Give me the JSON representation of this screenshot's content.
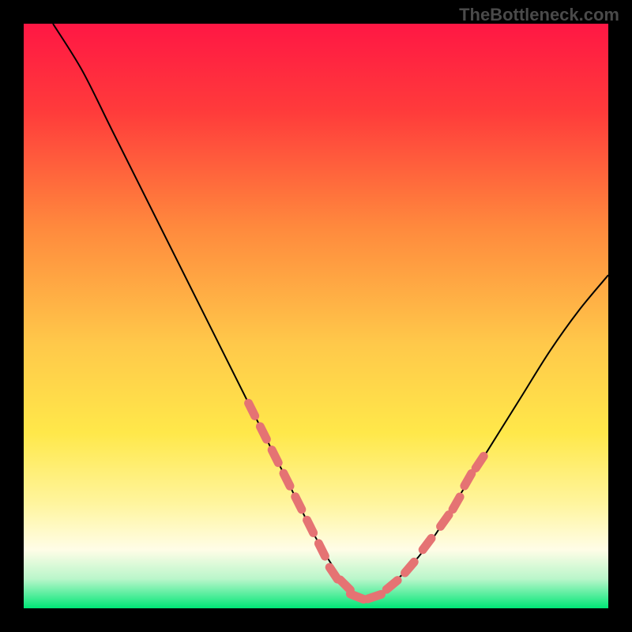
{
  "watermark": "TheBottleneck.com",
  "chart_data": {
    "type": "line",
    "title": "",
    "xlabel": "",
    "ylabel": "",
    "xlim": [
      0,
      100
    ],
    "ylim": [
      0,
      100
    ],
    "gradient_stops": [
      {
        "offset": 0,
        "color": "#ff1744"
      },
      {
        "offset": 15,
        "color": "#ff3b3b"
      },
      {
        "offset": 35,
        "color": "#ff8a3d"
      },
      {
        "offset": 55,
        "color": "#ffc94a"
      },
      {
        "offset": 70,
        "color": "#ffe84a"
      },
      {
        "offset": 82,
        "color": "#fff59d"
      },
      {
        "offset": 90,
        "color": "#fffde7"
      },
      {
        "offset": 95,
        "color": "#b9f6ca"
      },
      {
        "offset": 100,
        "color": "#00e676"
      }
    ],
    "series": [
      {
        "name": "bottleneck-curve",
        "x": [
          5,
          10,
          15,
          20,
          25,
          30,
          35,
          40,
          45,
          50,
          55,
          57,
          60,
          65,
          70,
          75,
          80,
          85,
          90,
          95,
          100
        ],
        "y": [
          100,
          92,
          82,
          72,
          62,
          52,
          42,
          32,
          22,
          12,
          4,
          2,
          2,
          6,
          12,
          20,
          28,
          36,
          44,
          51,
          57
        ]
      }
    ],
    "markers": {
      "name": "highlight-dots",
      "color": "#e57373",
      "points": [
        {
          "x": 39,
          "y": 34
        },
        {
          "x": 41,
          "y": 30
        },
        {
          "x": 43,
          "y": 26
        },
        {
          "x": 45,
          "y": 22
        },
        {
          "x": 47,
          "y": 18
        },
        {
          "x": 49,
          "y": 14
        },
        {
          "x": 51,
          "y": 10
        },
        {
          "x": 53,
          "y": 6
        },
        {
          "x": 55,
          "y": 4
        },
        {
          "x": 57,
          "y": 2
        },
        {
          "x": 60,
          "y": 2
        },
        {
          "x": 63,
          "y": 4
        },
        {
          "x": 66,
          "y": 7
        },
        {
          "x": 69,
          "y": 11
        },
        {
          "x": 72,
          "y": 15
        },
        {
          "x": 74,
          "y": 18
        },
        {
          "x": 76,
          "y": 22
        },
        {
          "x": 78,
          "y": 25
        }
      ]
    }
  }
}
